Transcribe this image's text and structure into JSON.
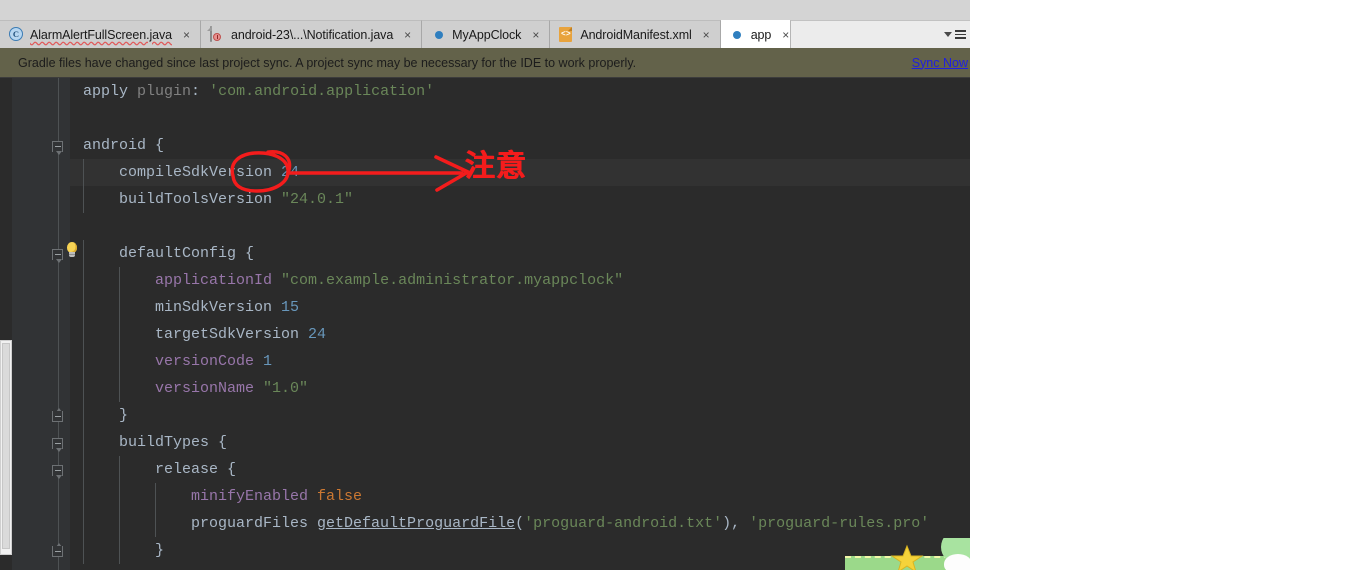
{
  "window": {
    "app": "Android Studio",
    "editor_theme": "Darcula"
  },
  "tabs": [
    {
      "label": "AlarmAlertFullScreen.java",
      "icon": "java-class-icon",
      "selected": false,
      "close": "×",
      "spellcheck_underline": true
    },
    {
      "label": "android-23\\...\\Notification.java",
      "icon": "readonly-file-icon",
      "selected": false,
      "close": "×",
      "spellcheck_underline": false
    },
    {
      "label": "MyAppClock",
      "icon": "gradle-icon",
      "selected": false,
      "close": "×",
      "spellcheck_underline": false
    },
    {
      "label": "AndroidManifest.xml",
      "icon": "xml-file-icon",
      "selected": false,
      "close": "×",
      "spellcheck_underline": false
    },
    {
      "label": "app",
      "icon": "gradle-icon",
      "selected": true,
      "close": "×",
      "spellcheck_underline": false
    }
  ],
  "toolbar": {
    "overflow_caret": "▾",
    "menu_icon": "hamburger-menu-icon"
  },
  "banner": {
    "message": "Gradle files have changed since last project sync. A project sync may be necessary for the IDE to work properly.",
    "link": "Sync Now",
    "background": "#63624a",
    "link_color": "#2020dd"
  },
  "code": {
    "language": "gradle",
    "lines": [
      {
        "indent": 0,
        "tokens": [
          {
            "t": "apply",
            "c": "white"
          },
          {
            "t": " ",
            "c": "plain"
          },
          {
            "t": "plugin",
            "c": "gray"
          },
          {
            "t": ": ",
            "c": "plain"
          },
          {
            "t": "'com.android.application'",
            "c": "str"
          }
        ]
      },
      {
        "indent": 0,
        "tokens": []
      },
      {
        "indent": 0,
        "fold": "down",
        "tokens": [
          {
            "t": "android",
            "c": "white"
          },
          {
            "t": " {",
            "c": "plain"
          }
        ]
      },
      {
        "indent": 1,
        "current": true,
        "bulb": true,
        "tokens": [
          {
            "t": "compileSdkVersion",
            "c": "white"
          },
          {
            "t": " ",
            "c": "plain"
          },
          {
            "t": "24",
            "c": "num"
          }
        ]
      },
      {
        "indent": 1,
        "tokens": [
          {
            "t": "buildToolsVersion",
            "c": "white"
          },
          {
            "t": " ",
            "c": "plain"
          },
          {
            "t": "\"24.0.1\"",
            "c": "str"
          }
        ]
      },
      {
        "indent": 0,
        "tokens": []
      },
      {
        "indent": 1,
        "fold": "down",
        "tokens": [
          {
            "t": "defaultConfig",
            "c": "white"
          },
          {
            "t": " {",
            "c": "plain"
          }
        ]
      },
      {
        "indent": 2,
        "tokens": [
          {
            "t": "applicationId",
            "c": "prop"
          },
          {
            "t": " ",
            "c": "plain"
          },
          {
            "t": "\"com.example.administrator.myappclock\"",
            "c": "str"
          }
        ]
      },
      {
        "indent": 2,
        "tokens": [
          {
            "t": "minSdkVersion",
            "c": "white"
          },
          {
            "t": " ",
            "c": "plain"
          },
          {
            "t": "15",
            "c": "num"
          }
        ]
      },
      {
        "indent": 2,
        "tokens": [
          {
            "t": "targetSdkVersion",
            "c": "white"
          },
          {
            "t": " ",
            "c": "plain"
          },
          {
            "t": "24",
            "c": "num"
          }
        ]
      },
      {
        "indent": 2,
        "tokens": [
          {
            "t": "versionCode",
            "c": "prop"
          },
          {
            "t": " ",
            "c": "plain"
          },
          {
            "t": "1",
            "c": "num"
          }
        ]
      },
      {
        "indent": 2,
        "tokens": [
          {
            "t": "versionName",
            "c": "prop"
          },
          {
            "t": " ",
            "c": "plain"
          },
          {
            "t": "\"1.0\"",
            "c": "str"
          }
        ]
      },
      {
        "indent": 1,
        "fold": "up",
        "tokens": [
          {
            "t": "}",
            "c": "plain"
          }
        ]
      },
      {
        "indent": 1,
        "fold": "down",
        "tokens": [
          {
            "t": "buildTypes",
            "c": "white"
          },
          {
            "t": " {",
            "c": "plain"
          }
        ]
      },
      {
        "indent": 2,
        "fold": "down",
        "tokens": [
          {
            "t": "release",
            "c": "white"
          },
          {
            "t": " {",
            "c": "plain"
          }
        ]
      },
      {
        "indent": 3,
        "tokens": [
          {
            "t": "minifyEnabled",
            "c": "prop"
          },
          {
            "t": " ",
            "c": "plain"
          },
          {
            "t": "false",
            "c": "kw"
          }
        ]
      },
      {
        "indent": 3,
        "tokens": [
          {
            "t": "proguardFiles",
            "c": "white"
          },
          {
            "t": " ",
            "c": "plain"
          },
          {
            "t": "getDefaultProguardFile",
            "c": "fn"
          },
          {
            "t": "(",
            "c": "plain"
          },
          {
            "t": "'proguard-android.txt'",
            "c": "str"
          },
          {
            "t": "), ",
            "c": "plain"
          },
          {
            "t": "'proguard-rules.pro'",
            "c": "str"
          }
        ]
      },
      {
        "indent": 2,
        "fold": "up",
        "tokens": [
          {
            "t": "}",
            "c": "plain"
          }
        ]
      }
    ]
  },
  "annotation": {
    "text": "注意",
    "color": "#f41c1c",
    "shape": "circle-and-arrow pointing at compileSdkVersion value 24",
    "target_value": "24"
  },
  "game_overlay": {
    "name": "star-and-character-widget",
    "star": "★",
    "ground_color": "#9bd98a",
    "character_color": "#a8e3a0"
  }
}
